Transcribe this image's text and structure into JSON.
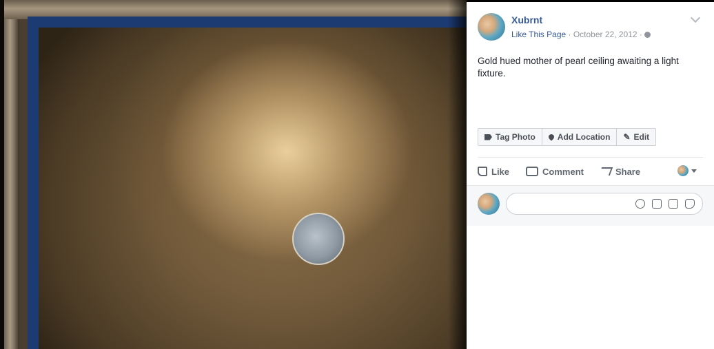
{
  "post": {
    "author": "Xubrnt",
    "like_page": "Like This Page",
    "separator": " · ",
    "date": "October 22, 2012",
    "audience_separator": " ·",
    "caption": "Gold hued mother of pearl ceiling awaiting a light fixture."
  },
  "photo_actions": {
    "tag_photo": "Tag Photo",
    "add_location": "Add Location",
    "edit": "Edit"
  },
  "reactions": {
    "like": "Like",
    "comment": "Comment",
    "share": "Share"
  },
  "comment": {
    "placeholder": ""
  },
  "icons": [
    "photo-image",
    "avatar",
    "chevron-down-icon",
    "globe-icon",
    "tag-icon",
    "pin-icon",
    "pencil-icon",
    "like-icon",
    "comment-icon",
    "share-icon",
    "emoji-icon",
    "camera-icon",
    "gif-icon",
    "sticker-icon"
  ],
  "colors": {
    "link": "#365899",
    "meta": "#90949c",
    "text": "#1d2129",
    "action_text": "#606770"
  }
}
